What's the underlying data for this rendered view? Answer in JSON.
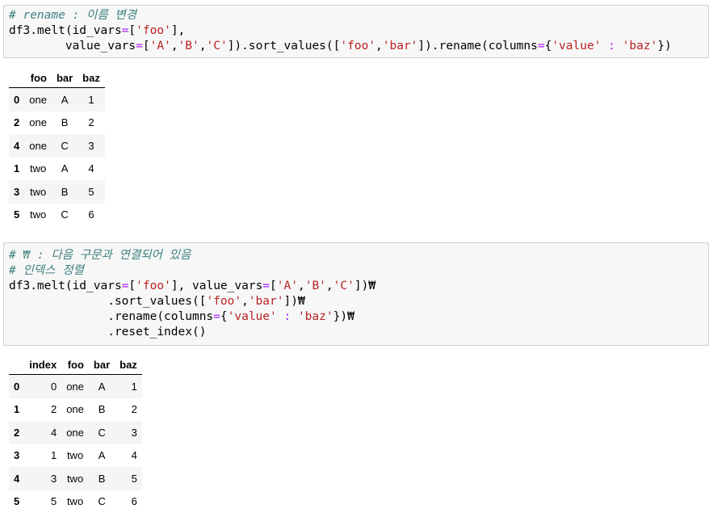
{
  "cell1": {
    "line1": "# rename : 이름 변경",
    "line2_a": "df3.melt(id_vars",
    "line2_b": "=",
    "line2_c": "[",
    "line2_d": "'foo'",
    "line2_e": "],",
    "line3_a": "        value_vars",
    "line3_b": "=",
    "line3_c": "[",
    "line3_d": "'A'",
    "line3_e": ",",
    "line3_f": "'B'",
    "line3_g": ",",
    "line3_h": "'C'",
    "line3_i": "]).sort_values([",
    "line3_j": "'foo'",
    "line3_k": ",",
    "line3_l": "'bar'",
    "line3_m": "]).rename(columns",
    "line3_n": "=",
    "line3_o": "{",
    "line3_p": "'value'",
    "line3_q": " : ",
    "line3_r": "'baz'",
    "line3_s": "})"
  },
  "table1": {
    "headers": [
      "",
      "foo",
      "bar",
      "baz"
    ],
    "rows": [
      {
        "idx": "0",
        "foo": "one",
        "bar": "A",
        "baz": "1"
      },
      {
        "idx": "2",
        "foo": "one",
        "bar": "B",
        "baz": "2"
      },
      {
        "idx": "4",
        "foo": "one",
        "bar": "C",
        "baz": "3"
      },
      {
        "idx": "1",
        "foo": "two",
        "bar": "A",
        "baz": "4"
      },
      {
        "idx": "3",
        "foo": "two",
        "bar": "B",
        "baz": "5"
      },
      {
        "idx": "5",
        "foo": "two",
        "bar": "C",
        "baz": "6"
      }
    ]
  },
  "cell2": {
    "line1": "# ₩ : 다음 구문과 연결되어 있음",
    "line2": "# 인덱스 정렬",
    "line3_a": "df3.melt(id_vars",
    "line3_b": "=",
    "line3_c": "[",
    "line3_d": "'foo'",
    "line3_e": "], value_vars",
    "line3_f": "=",
    "line3_g": "[",
    "line3_h": "'A'",
    "line3_i": ",",
    "line3_j": "'B'",
    "line3_k": ",",
    "line3_l": "'C'",
    "line3_m": "])₩",
    "line4_a": "              .sort_values([",
    "line4_b": "'foo'",
    "line4_c": ",",
    "line4_d": "'bar'",
    "line4_e": "])₩",
    "line5_a": "              .rename(columns",
    "line5_b": "=",
    "line5_c": "{",
    "line5_d": "'value'",
    "line5_e": " : ",
    "line5_f": "'baz'",
    "line5_g": "})₩",
    "line6": "              .reset_index()"
  },
  "table2": {
    "headers": [
      "",
      "index",
      "foo",
      "bar",
      "baz"
    ],
    "rows": [
      {
        "idx": "0",
        "index": "0",
        "foo": "one",
        "bar": "A",
        "baz": "1"
      },
      {
        "idx": "1",
        "index": "2",
        "foo": "one",
        "bar": "B",
        "baz": "2"
      },
      {
        "idx": "2",
        "index": "4",
        "foo": "one",
        "bar": "C",
        "baz": "3"
      },
      {
        "idx": "3",
        "index": "1",
        "foo": "two",
        "bar": "A",
        "baz": "4"
      },
      {
        "idx": "4",
        "index": "3",
        "foo": "two",
        "bar": "B",
        "baz": "5"
      },
      {
        "idx": "5",
        "index": "5",
        "foo": "two",
        "bar": "C",
        "baz": "6"
      }
    ]
  }
}
